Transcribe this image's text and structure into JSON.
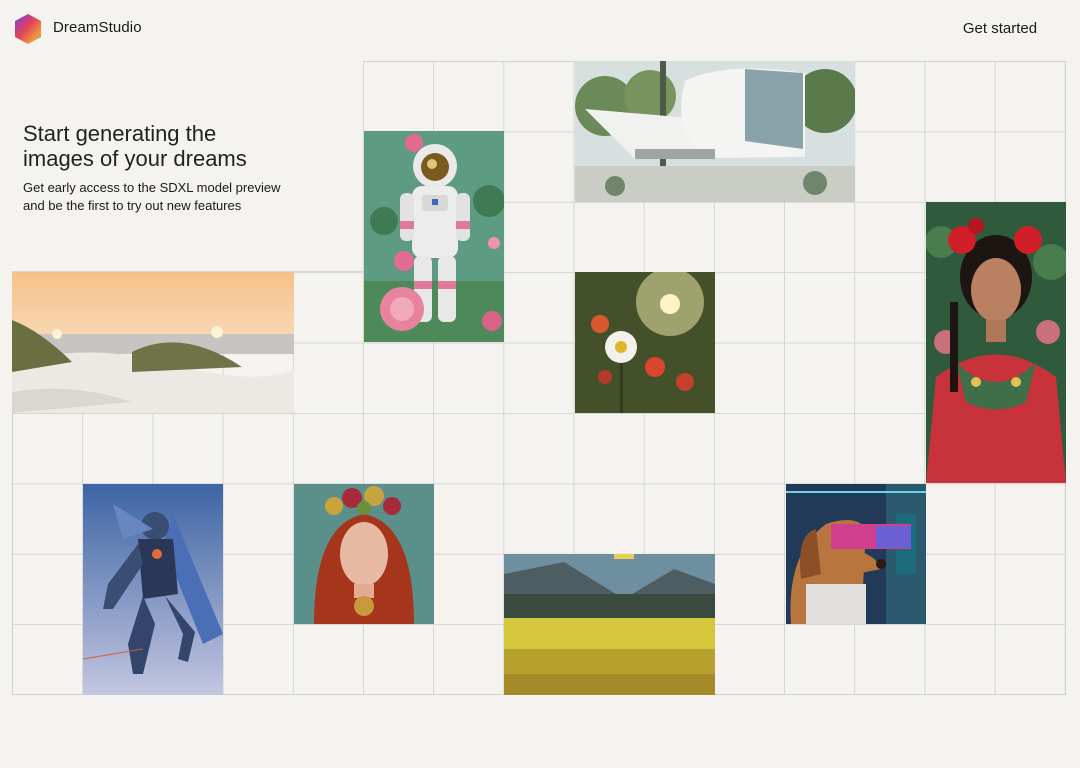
{
  "header": {
    "brand": "DreamStudio",
    "cta_label": "Get started",
    "logo_icon": "hexagon-gradient-logo"
  },
  "hero": {
    "headline_line1": "Start generating the",
    "headline_line2": "images of your dreams",
    "subtext_line1": "Get early access to the SDXL model preview",
    "subtext_line2": "and be the first to try out new features"
  },
  "gallery": [
    {
      "subject": "astronaut among roses",
      "icon": "image-astronaut"
    },
    {
      "subject": "modern white house",
      "icon": "image-architecture"
    },
    {
      "subject": "frida portrait",
      "icon": "image-portrait-flowers"
    },
    {
      "subject": "beach dunes at sunset",
      "icon": "image-beach-dunes"
    },
    {
      "subject": "daisy flower",
      "icon": "image-daisy"
    },
    {
      "subject": "flying robot warrior",
      "icon": "image-robot"
    },
    {
      "subject": "woman with flower crown",
      "icon": "image-red-hair-woman"
    },
    {
      "subject": "mountain flower meadow",
      "icon": "image-mountain-meadow"
    },
    {
      "subject": "dog wearing VR headset",
      "icon": "image-vr-dog"
    }
  ],
  "colors": {
    "background": "#f4f3ef",
    "grid_line": "#d5d5d1",
    "text": "#1a1a1a"
  }
}
